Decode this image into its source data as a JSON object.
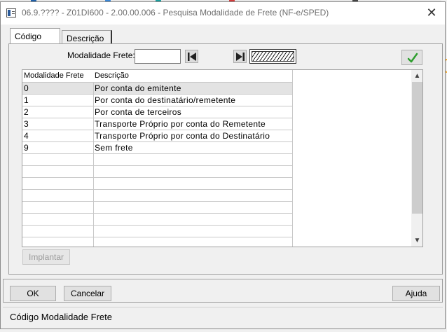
{
  "window": {
    "title": "06.9.???? - Z01DI600 - 2.00.00.006 - Pesquisa Modalidade de Frete (NF-e/SPED)",
    "close_glyph": "✕"
  },
  "tabs": [
    {
      "label": "Código",
      "active": true
    },
    {
      "label": "Descrição",
      "active": false
    }
  ],
  "search": {
    "label": "Modalidade Frete:",
    "value": ""
  },
  "grid": {
    "headers": [
      "Modalidade Frete",
      "Descrição"
    ],
    "rows": [
      {
        "code": "0",
        "desc": "Por conta do emitente",
        "selected": true
      },
      {
        "code": "1",
        "desc": "Por conta do destinatário/remetente",
        "selected": false
      },
      {
        "code": "2",
        "desc": "Por conta de terceiros",
        "selected": false
      },
      {
        "code": "3",
        "desc": "Transporte Próprio por conta do Remetente",
        "selected": false
      },
      {
        "code": "4",
        "desc": "Transporte Próprio por conta do Destinatário",
        "selected": false
      },
      {
        "code": "9",
        "desc": "Sem frete",
        "selected": false
      },
      {
        "code": "",
        "desc": "",
        "selected": false
      },
      {
        "code": "",
        "desc": "",
        "selected": false
      },
      {
        "code": "",
        "desc": "",
        "selected": false
      },
      {
        "code": "",
        "desc": "",
        "selected": false
      },
      {
        "code": "",
        "desc": "",
        "selected": false
      },
      {
        "code": "",
        "desc": "",
        "selected": false
      },
      {
        "code": "",
        "desc": "",
        "selected": false
      },
      {
        "code": "",
        "desc": "",
        "selected": false
      }
    ],
    "scroll_up_glyph": "▲",
    "scroll_down_glyph": "▼"
  },
  "buttons": {
    "implantar": "Implantar",
    "ok": "OK",
    "cancelar": "Cancelar",
    "ajuda": "Ajuda"
  },
  "status": {
    "text": "Código Modalidade Frete"
  },
  "icons": {
    "first": "skip-first-icon",
    "last": "skip-last-icon",
    "confirm": "checkmark-icon",
    "app": "app-window-icon"
  },
  "colors": {
    "check_green": "#2e9e2e",
    "selected_row": "#e3e3e3"
  }
}
